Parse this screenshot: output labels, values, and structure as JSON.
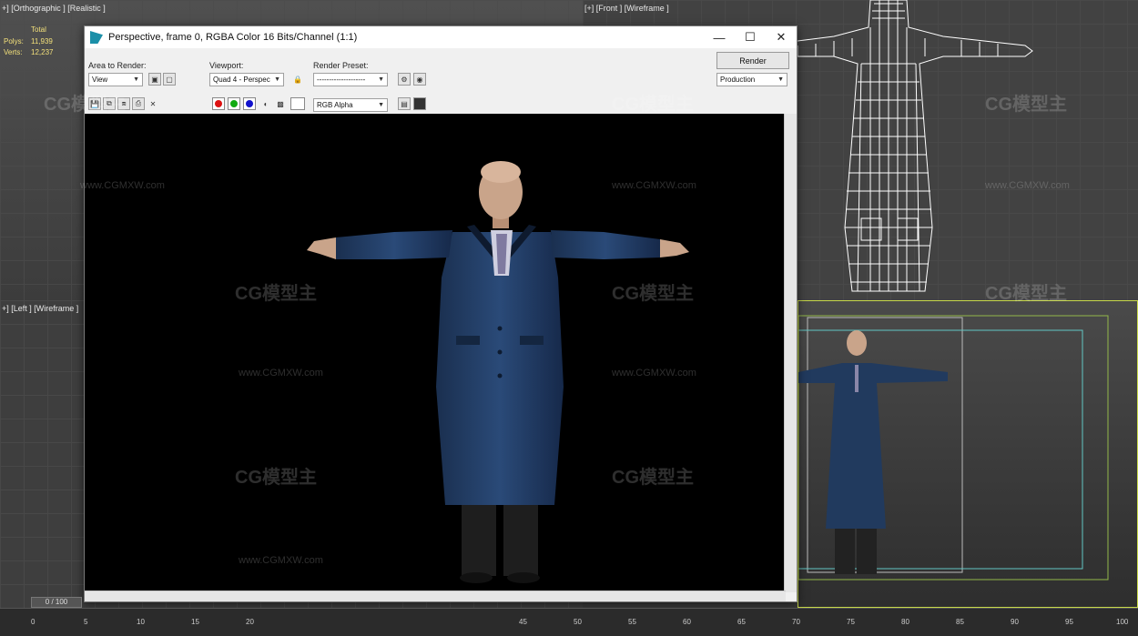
{
  "viewports": {
    "top_left_label": "+] [Orthographic ] [Realistic ]",
    "top_left_stats": {
      "total": "Total",
      "polys_label": "Polys:",
      "polys": "11,939",
      "verts_label": "Verts:",
      "verts": "12,237"
    },
    "top_right_label": "[+] [Front ] [Wireframe ]",
    "bottom_left_label": "+] [Left ] [Wireframe ]"
  },
  "render_window": {
    "title": "Perspective, frame 0, RGBA Color 16 Bits/Channel (1:1)",
    "area_to_render_label": "Area to Render:",
    "area_to_render_value": "View",
    "viewport_label": "Viewport:",
    "viewport_value": "Quad 4 - Perspec",
    "render_preset_label": "Render Preset:",
    "render_preset_value": "--------------------",
    "render_button": "Render",
    "production_value": "Production",
    "channel_value": "RGB Alpha",
    "minimize": "—",
    "maximize": "☐",
    "close": "✕"
  },
  "timeline": {
    "frame_counter": "0 / 100",
    "ticks": [
      "0",
      "5",
      "10",
      "15",
      "20",
      "45",
      "50",
      "55",
      "60",
      "65",
      "70",
      "75",
      "80",
      "85",
      "90",
      "95",
      "100"
    ]
  },
  "watermarks": {
    "brand": "CG模型主",
    "url": "www.CGMXW.com"
  },
  "colors": {
    "coat": "#213a5e",
    "render_bg": "#000000",
    "window_bg": "#f0f0f0",
    "safe_frame": "#c8d94a"
  }
}
